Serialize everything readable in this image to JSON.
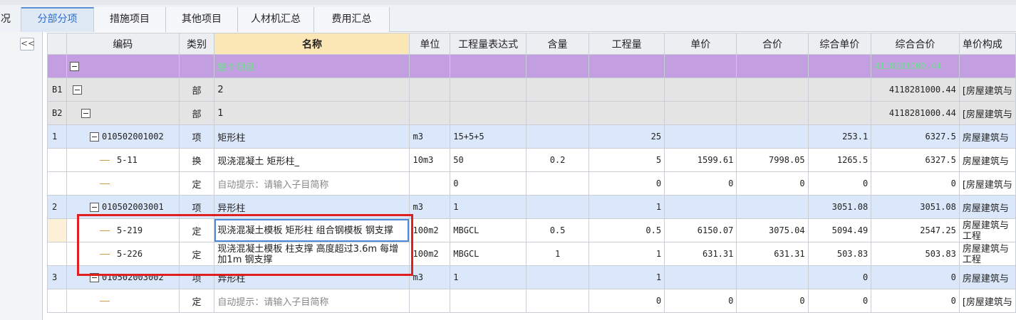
{
  "tabs": [
    "况",
    "分部分项",
    "措施项目",
    "其他项目",
    "人材机汇总",
    "费用汇总"
  ],
  "active_tab": "分部分项",
  "left_panel": {
    "collapse_glyph": "<<"
  },
  "columns": [
    "",
    "编码",
    "类别",
    "名称",
    "单位",
    "工程量表达式",
    "含量",
    "工程量",
    "单价",
    "合价",
    "综合单价",
    "综合合价",
    "单价构成"
  ],
  "root_row": {
    "name": "整个项目",
    "total": "4118281000.44"
  },
  "rows": [
    {
      "idx": "B1",
      "code": "",
      "kind": "部",
      "name": "2",
      "unit": "",
      "expr": "",
      "content": "",
      "qty": "",
      "price": "",
      "sum": "",
      "unit_total": "",
      "total": "4118281000.44",
      "compose": "[房屋建筑与"
    },
    {
      "idx": "B2",
      "code": "",
      "kind": "部",
      "name": "1",
      "unit": "",
      "expr": "",
      "content": "",
      "qty": "",
      "price": "",
      "sum": "",
      "unit_total": "",
      "total": "4118281000.44",
      "compose": "[房屋建筑与"
    },
    {
      "idx": "1",
      "code": "010502001002",
      "kind": "项",
      "name": "矩形柱",
      "unit": "m3",
      "expr": "15+5+5",
      "content": "",
      "qty": "25",
      "price": "",
      "sum": "",
      "unit_total": "253.1",
      "total": "6327.5",
      "compose": "房屋建筑与"
    },
    {
      "idx": "",
      "code": "5-11",
      "kind": "换",
      "name": "现浇混凝土 矩形柱_",
      "unit": "10m3",
      "expr": "50",
      "content": "0.2",
      "qty": "5",
      "price": "1599.61",
      "sum": "7998.05",
      "unit_total": "1265.5",
      "total": "6327.5",
      "compose": "房屋建筑与"
    },
    {
      "idx": "",
      "code": "",
      "kind": "定",
      "name": "自动提示：请输入子目简称",
      "unit": "",
      "expr": "0",
      "content": "",
      "qty": "0",
      "price": "0",
      "sum": "0",
      "unit_total": "0",
      "total": "0",
      "compose": "[房屋建筑与"
    },
    {
      "idx": "2",
      "code": "010502003001",
      "kind": "项",
      "name": "异形柱",
      "unit": "m3",
      "expr": "1",
      "content": "",
      "qty": "1",
      "price": "",
      "sum": "",
      "unit_total": "3051.08",
      "total": "3051.08",
      "compose": "房屋建筑与"
    },
    {
      "idx": "",
      "code": "5-219",
      "kind": "定",
      "name": "现浇混凝土模板 矩形柱 组合钢模板 钢支撑",
      "unit": "100m2",
      "expr": "MBGCL",
      "content": "0.5",
      "qty": "0.5",
      "price": "6150.07",
      "sum": "3075.04",
      "unit_total": "5094.49",
      "total": "2547.25",
      "compose": "房屋建筑与工程"
    },
    {
      "idx": "",
      "code": "5-226",
      "kind": "定",
      "name": "现浇混凝土模板 柱支撑 高度超过3.6m 每增加1m 钢支撑",
      "unit": "100m2",
      "expr": "MBGCL",
      "content": "1",
      "qty": "1",
      "price": "631.31",
      "sum": "631.31",
      "unit_total": "503.83",
      "total": "503.83",
      "compose": "房屋建筑与工程"
    },
    {
      "idx": "3",
      "code": "010502003002",
      "kind": "项",
      "name": "异形柱",
      "unit": "m3",
      "expr": "1",
      "content": "",
      "qty": "1",
      "price": "",
      "sum": "",
      "unit_total": "0",
      "total": "0",
      "compose": "房屋建筑与"
    },
    {
      "idx": "",
      "code": "",
      "kind": "定",
      "name": "自动提示：请输入子目简称",
      "unit": "",
      "expr": "",
      "content": "",
      "qty": "0",
      "price": "0",
      "sum": "0",
      "unit_total": "0",
      "total": "0",
      "compose": "[房屋建筑与"
    }
  ]
}
